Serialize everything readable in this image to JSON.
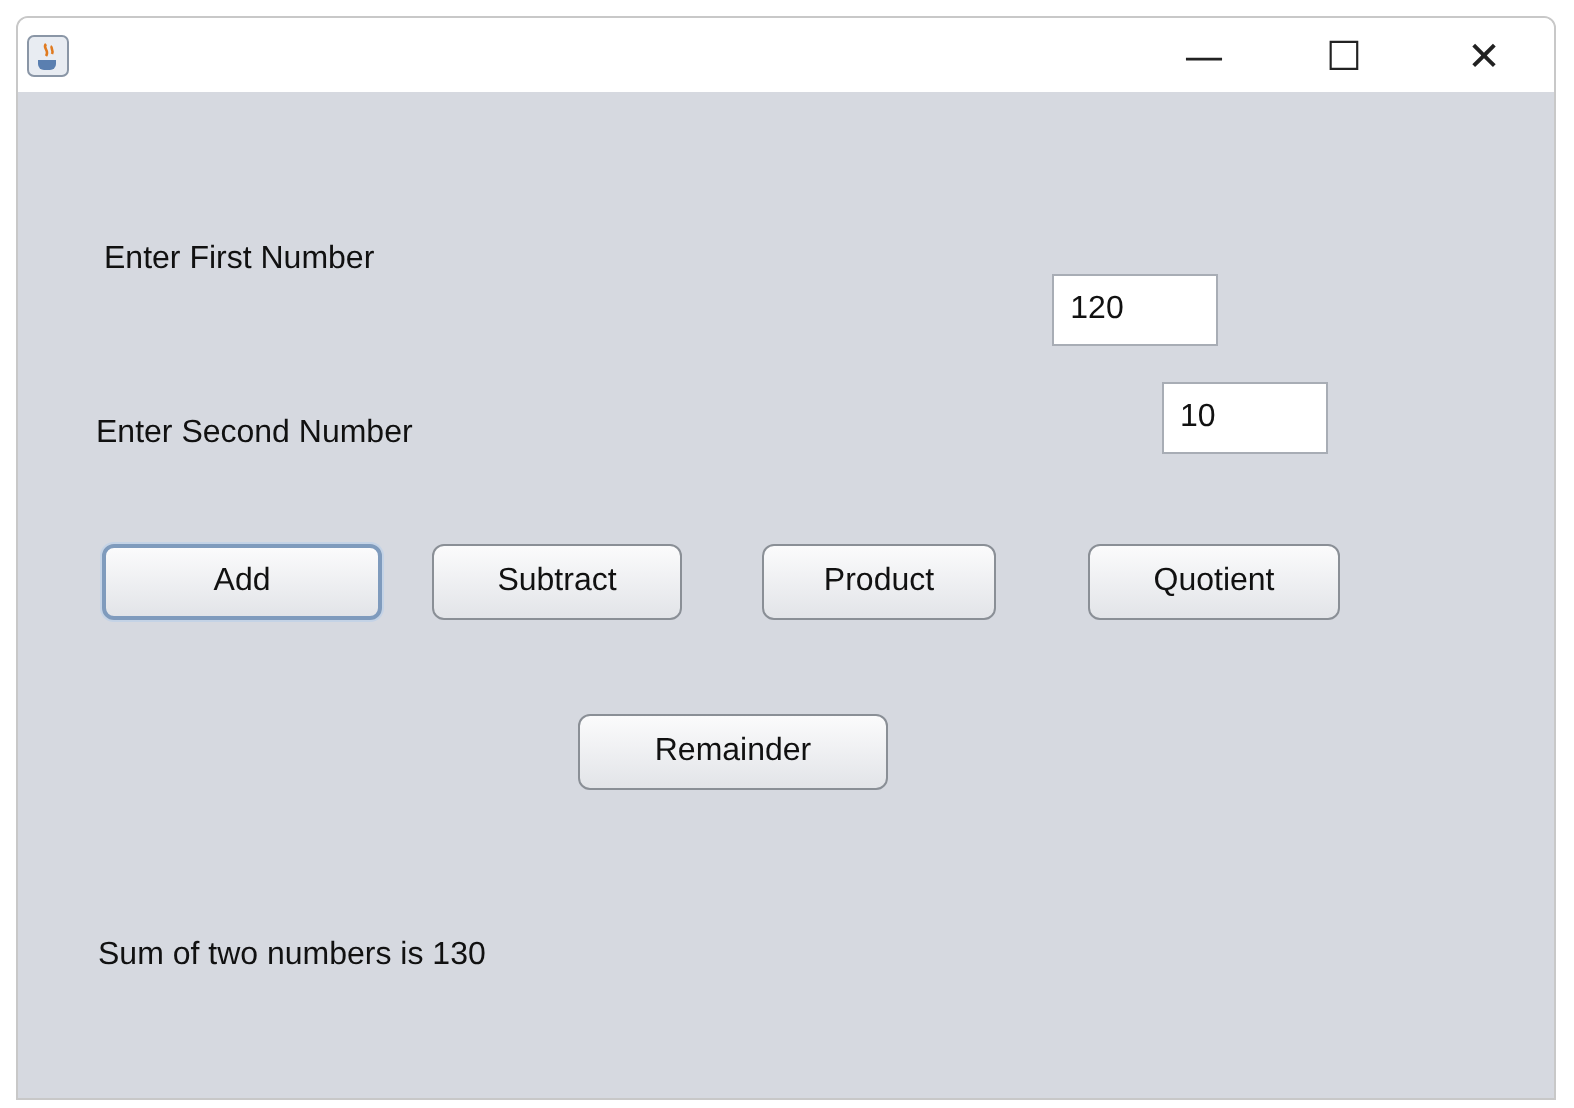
{
  "window": {
    "title_buttons": [
      "—",
      "☐",
      "✕"
    ]
  },
  "first": {
    "label": "Enter First Number",
    "value": "120"
  },
  "second": {
    "label": "Enter Second Number",
    "value": "10"
  },
  "buttons": [
    {
      "label": "Add",
      "focused": true
    },
    {
      "label": "Subtract",
      "focused": false
    },
    {
      "label": "Product",
      "focused": false
    },
    {
      "label": "Quotient",
      "focused": false
    }
  ],
  "extra_button": {
    "label": "Remainder",
    "focused": false
  },
  "result": "Sum of two numbers is 130"
}
